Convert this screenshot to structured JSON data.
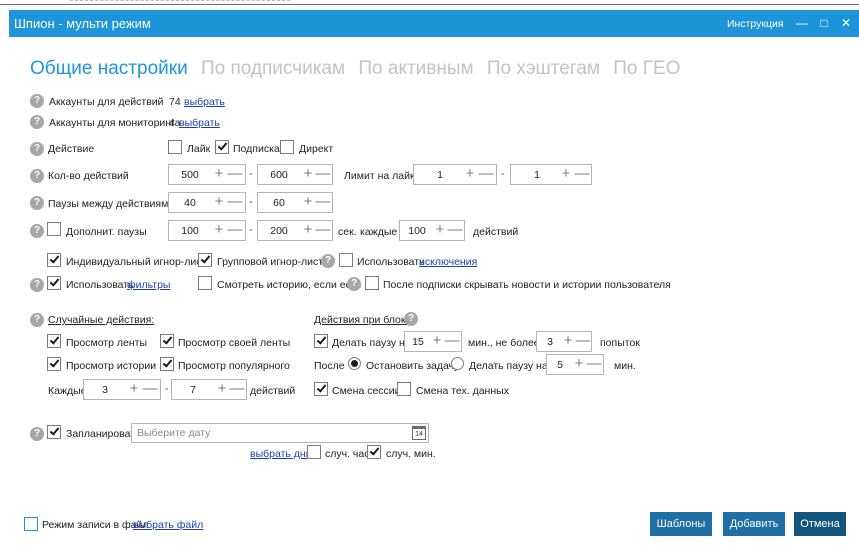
{
  "window": {
    "title": "Шпион - мульти режим",
    "help_link": "Инструкция"
  },
  "tabs": [
    {
      "label": "Общие настройки",
      "active": true
    },
    {
      "label": "По подписчикам",
      "active": false
    },
    {
      "label": "По активным",
      "active": false
    },
    {
      "label": "По хэштегам",
      "active": false
    },
    {
      "label": "По ГЕО",
      "active": false
    }
  ],
  "accounts": {
    "actions_label": "Аккаунты для действий",
    "actions_count": "74",
    "monitoring_label": "Аккаунты для мониторинга",
    "monitoring_count": "4",
    "choose_link": "выбрать"
  },
  "action": {
    "label": "Действие",
    "like": {
      "label": "Лайк",
      "checked": false
    },
    "follow": {
      "label": "Подписка",
      "checked": true
    },
    "direct": {
      "label": "Директ",
      "checked": false
    }
  },
  "count": {
    "label": "Кол-во действий",
    "from": "500",
    "to": "600",
    "like_limit_label": "Лимит на лайки",
    "like_from": "1",
    "like_to": "1"
  },
  "pauses": {
    "label": "Паузы между действиями",
    "from": "40",
    "to": "60"
  },
  "extra_pauses": {
    "label": "Дополнит. паузы",
    "checked": false,
    "from": "100",
    "to": "200",
    "sec_label": "сек.",
    "each_label": "каждые",
    "each": "100",
    "actions_label": "действий"
  },
  "ignore": {
    "individual": {
      "label": "Индивидуальный игнор-лист",
      "checked": true
    },
    "group": {
      "label": "Групповой игнор-лист",
      "checked": true
    },
    "use_exceptions": {
      "label": "Использовать",
      "link": "исключения",
      "checked": false
    }
  },
  "filters": {
    "use": {
      "label": "Использовать",
      "link": "фильтры",
      "checked": true
    },
    "watch_story": {
      "label": "Смотреть историю, если есть",
      "checked": false
    },
    "hide_after": {
      "label": "После подписки скрывать новости и истории пользователя",
      "checked": false
    }
  },
  "random": {
    "title": "Случайные действия:",
    "feed": {
      "label": "Просмотр ленты",
      "checked": true
    },
    "own_feed": {
      "label": "Просмотр своей ленты",
      "checked": true
    },
    "stories": {
      "label": "Просмотр истории",
      "checked": true
    },
    "popular": {
      "label": "Просмотр популярного",
      "checked": true
    },
    "every_label": "Каждые",
    "from": "3",
    "to": "7",
    "actions_label": "действий"
  },
  "block": {
    "title": "Действия при блоке:",
    "pause": {
      "label": "Делать паузу на",
      "checked": true,
      "minutes": "15",
      "min_label": "мин., не более",
      "attempts": "3",
      "attempts_label": "попыток"
    },
    "after_label": "После",
    "stop_task": {
      "label": "Остановить задачу",
      "selected": true
    },
    "pause_for": {
      "label": "Делать паузу на",
      "selected": false,
      "minutes": "5",
      "min_label": "мин."
    },
    "session_change": {
      "label": "Смена сессии",
      "checked": true
    },
    "tech_change": {
      "label": "Смена тех. данных",
      "checked": false
    }
  },
  "schedule": {
    "label": "Запланировать",
    "checked": true,
    "placeholder": "Выберите дату",
    "calendar_day": "14",
    "choose_days": "выбрать дни",
    "rand_hour": {
      "label": "случ. час",
      "checked": false
    },
    "rand_min": {
      "label": "случ. мин.",
      "checked": true
    }
  },
  "footer": {
    "file_mode": {
      "label": "Режим записи в файл",
      "link": "выбрать файл",
      "checked": false
    },
    "templates": "Шаблоны",
    "add": "Добавить",
    "cancel": "Отмена"
  },
  "colors": {
    "accent": "#1e95d8",
    "button": "#1f6fa5",
    "button_dark": "#15547e",
    "link": "#1d3fb3"
  }
}
